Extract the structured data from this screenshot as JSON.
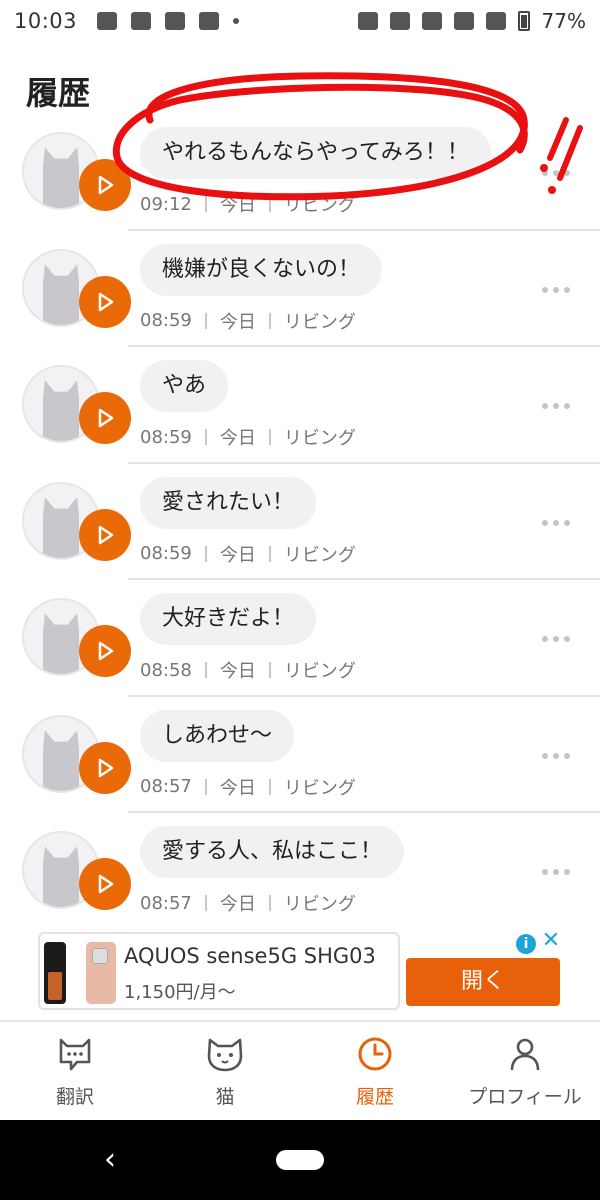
{
  "status_bar": {
    "time": "10:03",
    "battery": "77%"
  },
  "page": {
    "title": "履歴"
  },
  "history": [
    {
      "text": "やれるもんならやってみろ！！",
      "time": "09:12",
      "day": "今日",
      "room": "リビング"
    },
    {
      "text": "機嫌が良くないの！",
      "time": "08:59",
      "day": "今日",
      "room": "リビング"
    },
    {
      "text": "やあ",
      "time": "08:59",
      "day": "今日",
      "room": "リビング"
    },
    {
      "text": "愛されたい！",
      "time": "08:59",
      "day": "今日",
      "room": "リビング"
    },
    {
      "text": "大好きだよ！",
      "time": "08:58",
      "day": "今日",
      "room": "リビング"
    },
    {
      "text": "しあわせ〜",
      "time": "08:57",
      "day": "今日",
      "room": "リビング"
    },
    {
      "text": "愛する人、私はここ！",
      "time": "08:57",
      "day": "今日",
      "room": "リビング"
    }
  ],
  "ad": {
    "title": "AQUOS sense5G SHG03",
    "price": "1,150円/月〜",
    "open_label": "開く",
    "info_icon": "info-icon",
    "close_icon": "close-icon"
  },
  "bottom_nav": {
    "items": [
      {
        "label": "翻訳",
        "icon": "chat-cat-icon",
        "active": false
      },
      {
        "label": "猫",
        "icon": "cat-face-icon",
        "active": false
      },
      {
        "label": "履歴",
        "icon": "clock-icon",
        "active": true
      },
      {
        "label": "プロフィール",
        "icon": "person-icon",
        "active": false
      }
    ]
  },
  "colors": {
    "accent": "#e8610a",
    "annotation": "#e81010",
    "ad_info": "#1aa7d8"
  }
}
